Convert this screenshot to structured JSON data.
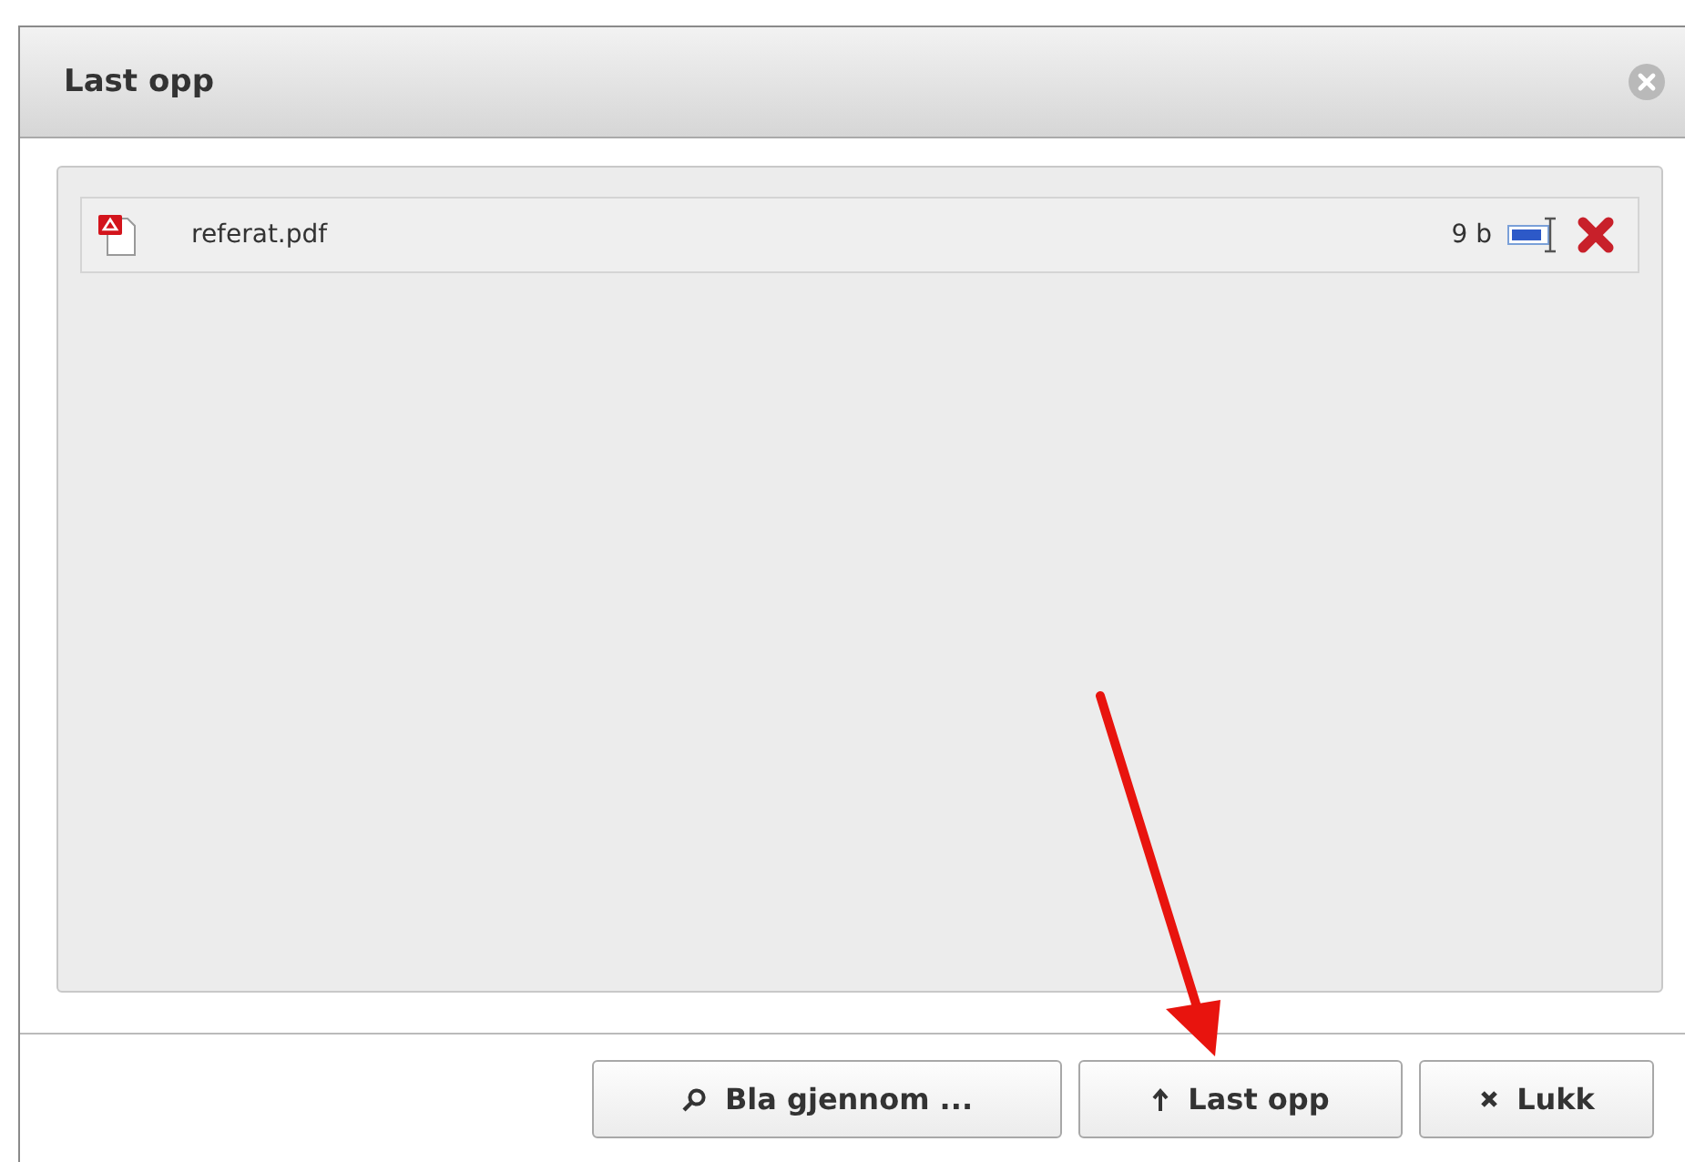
{
  "dialog": {
    "title": "Last opp"
  },
  "files": [
    {
      "name": "referat.pdf",
      "size": "9 b"
    }
  ],
  "buttons": [
    {
      "kind": "browse",
      "label": "Bla gjennom ..."
    },
    {
      "kind": "upload",
      "label": "Last opp"
    },
    {
      "kind": "close",
      "label": "Lukk"
    }
  ]
}
